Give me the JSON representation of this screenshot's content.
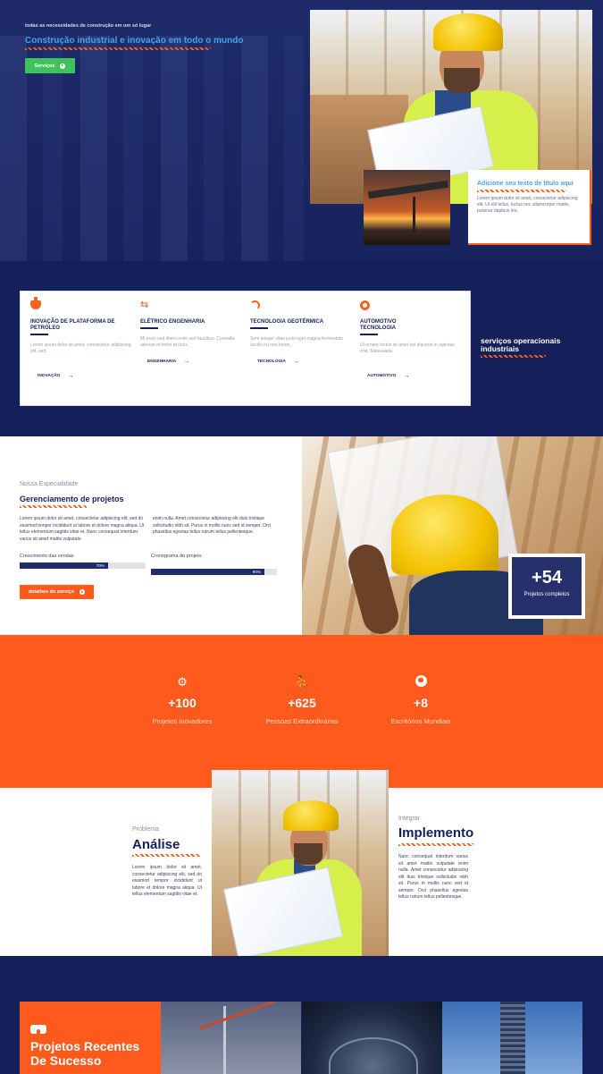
{
  "hero": {
    "kicker": "todas as necessidades de construção em um só lugar",
    "title": "Construção industrial e inovação em todo o mundo",
    "button_label": "Serviços",
    "card_title": "Adicione seu texto de título aqui",
    "card_text": "Lorem ipsum dolor sit amet, consectetur adipiscing elit. Ut elit tellus, luctus nec ullamcorper mattis, pulvinar dapibus leo."
  },
  "features": [
    {
      "icon": "oil-platform-icon",
      "title": "INOVAÇÃO DE PLATAFORMA DE PETRÓLEO",
      "text": "Lorem ipsum dolor sit amet, consectetur adipiscing elit, sed.",
      "link": "INOVAÇÃO"
    },
    {
      "icon": "usb-icon",
      "title": "ELÉTRICO ENGENHARIA",
      "text": "Mi proin sed libero enim sed faucibus. Convallis aenean et tortor at risus.",
      "link": "ENGENHARIA"
    },
    {
      "icon": "signal-icon",
      "title": "TECNOLOGIA GEOTÉRMICA",
      "text": "Sem integer vitae justo eget magna fermentum iaculis eu non lorem.",
      "link": "TECNOLOGIA"
    },
    {
      "icon": "steam-icon",
      "title": "AUTOMOTIVO TECNOLOGIA",
      "text": "Ut ornare lectus sit amet est placerat in egestas erat. Malesuada.",
      "link": "AUTOMOTIVO"
    }
  ],
  "services_heading": "serviços operacionais industriais",
  "specialty": {
    "kicker": "Nossa Especialidade",
    "title": "Gerenciamento de projetos",
    "col1": "Lorem ipsum dolor sit amet, consectetur adipiscing elit, sed do eiusmod tempor incididunt ut labore et dolore magna aliqua. Ut tellus elementum sagittis vitae et. Nunc consequat interdum varius sit amet mattis vulputate",
    "col2": "enim nulla. Amet consectetur adipiscing elit duis tristique sollicitudin nibh sit. Purus in mollis nunc sed id semper. Orci phasellus egestas tellus rutrum tellus pellentesque.",
    "bar1_label": "Crescimento das vendas",
    "bar1_value": 0.7,
    "bar1_text": "70%",
    "bar2_label": "Cronograma do projeto",
    "bar2_value": 0.9,
    "bar2_text": "90%",
    "button_label": "detalhes do serviço",
    "projects_number": "+54",
    "projects_label": "Projetos completos"
  },
  "stats": [
    {
      "icon": "gears-icon",
      "number": "+100",
      "label": "Projetos Inovadores"
    },
    {
      "icon": "people-icon",
      "number": "+625",
      "label": "Pessoas Extraordinárias"
    },
    {
      "icon": "globe-icon",
      "number": "+8",
      "label": "Escritórios Mundiais"
    }
  ],
  "analysis": {
    "left_kicker": "Problema",
    "left_title": "Análise",
    "left_text": "Lorem ipsum dolor sit amet, consectetur adipiscing elit, sed do eiusmod tempor incididunt ut labore et dolore magna aliqua. Ut tellus elementum sagittis vitae et.",
    "right_kicker": "Integrar",
    "right_title": "Implemento",
    "right_text": "Nunc consequat interdum varius sit amet mattis vulputate enim nulla. Amet consectetur adipiscing elit duis tristique sollicitudin nibh sit. Purus in mollis nunc sed id semper. Orci phasellus egestas tellus rutrum tellus pellentesque."
  },
  "recent": {
    "title": "Projetos Recentes De Sucesso"
  },
  "colors": {
    "navy": "#14205a",
    "orange": "#fe5a1d",
    "green": "#3ec35b",
    "accent_blue": "#4aa3e8"
  }
}
